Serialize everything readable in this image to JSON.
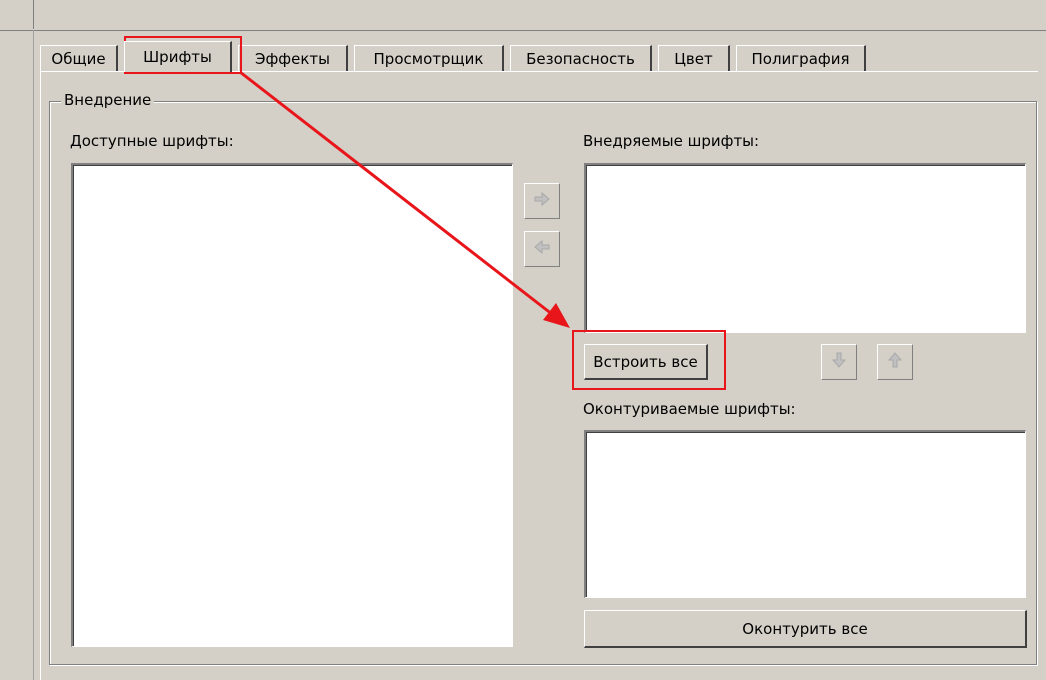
{
  "tabs": [
    {
      "label": "Общие",
      "active": false
    },
    {
      "label": "Шрифты",
      "active": true
    },
    {
      "label": "Эффекты",
      "active": false
    },
    {
      "label": "Просмотрщик",
      "active": false
    },
    {
      "label": "Безопасность",
      "active": false
    },
    {
      "label": "Цвет",
      "active": false
    },
    {
      "label": "Полиграфия",
      "active": false
    }
  ],
  "embedding": {
    "group_title": "Внедрение",
    "available_label": "Доступные шрифты:",
    "embedded_label": "Внедряемые шрифты:",
    "outlined_label": "Оконтуриваемые шрифты:",
    "embed_all_button": "Встроить все",
    "outline_all_button": "Оконтурить все"
  },
  "icons": {
    "move_right": "arrow-right-icon",
    "move_left": "arrow-left-icon",
    "move_down": "arrow-down-icon",
    "move_up": "arrow-up-icon"
  },
  "colors": {
    "annotation": "#e8161b",
    "window_bg": "#d4d0c8"
  }
}
